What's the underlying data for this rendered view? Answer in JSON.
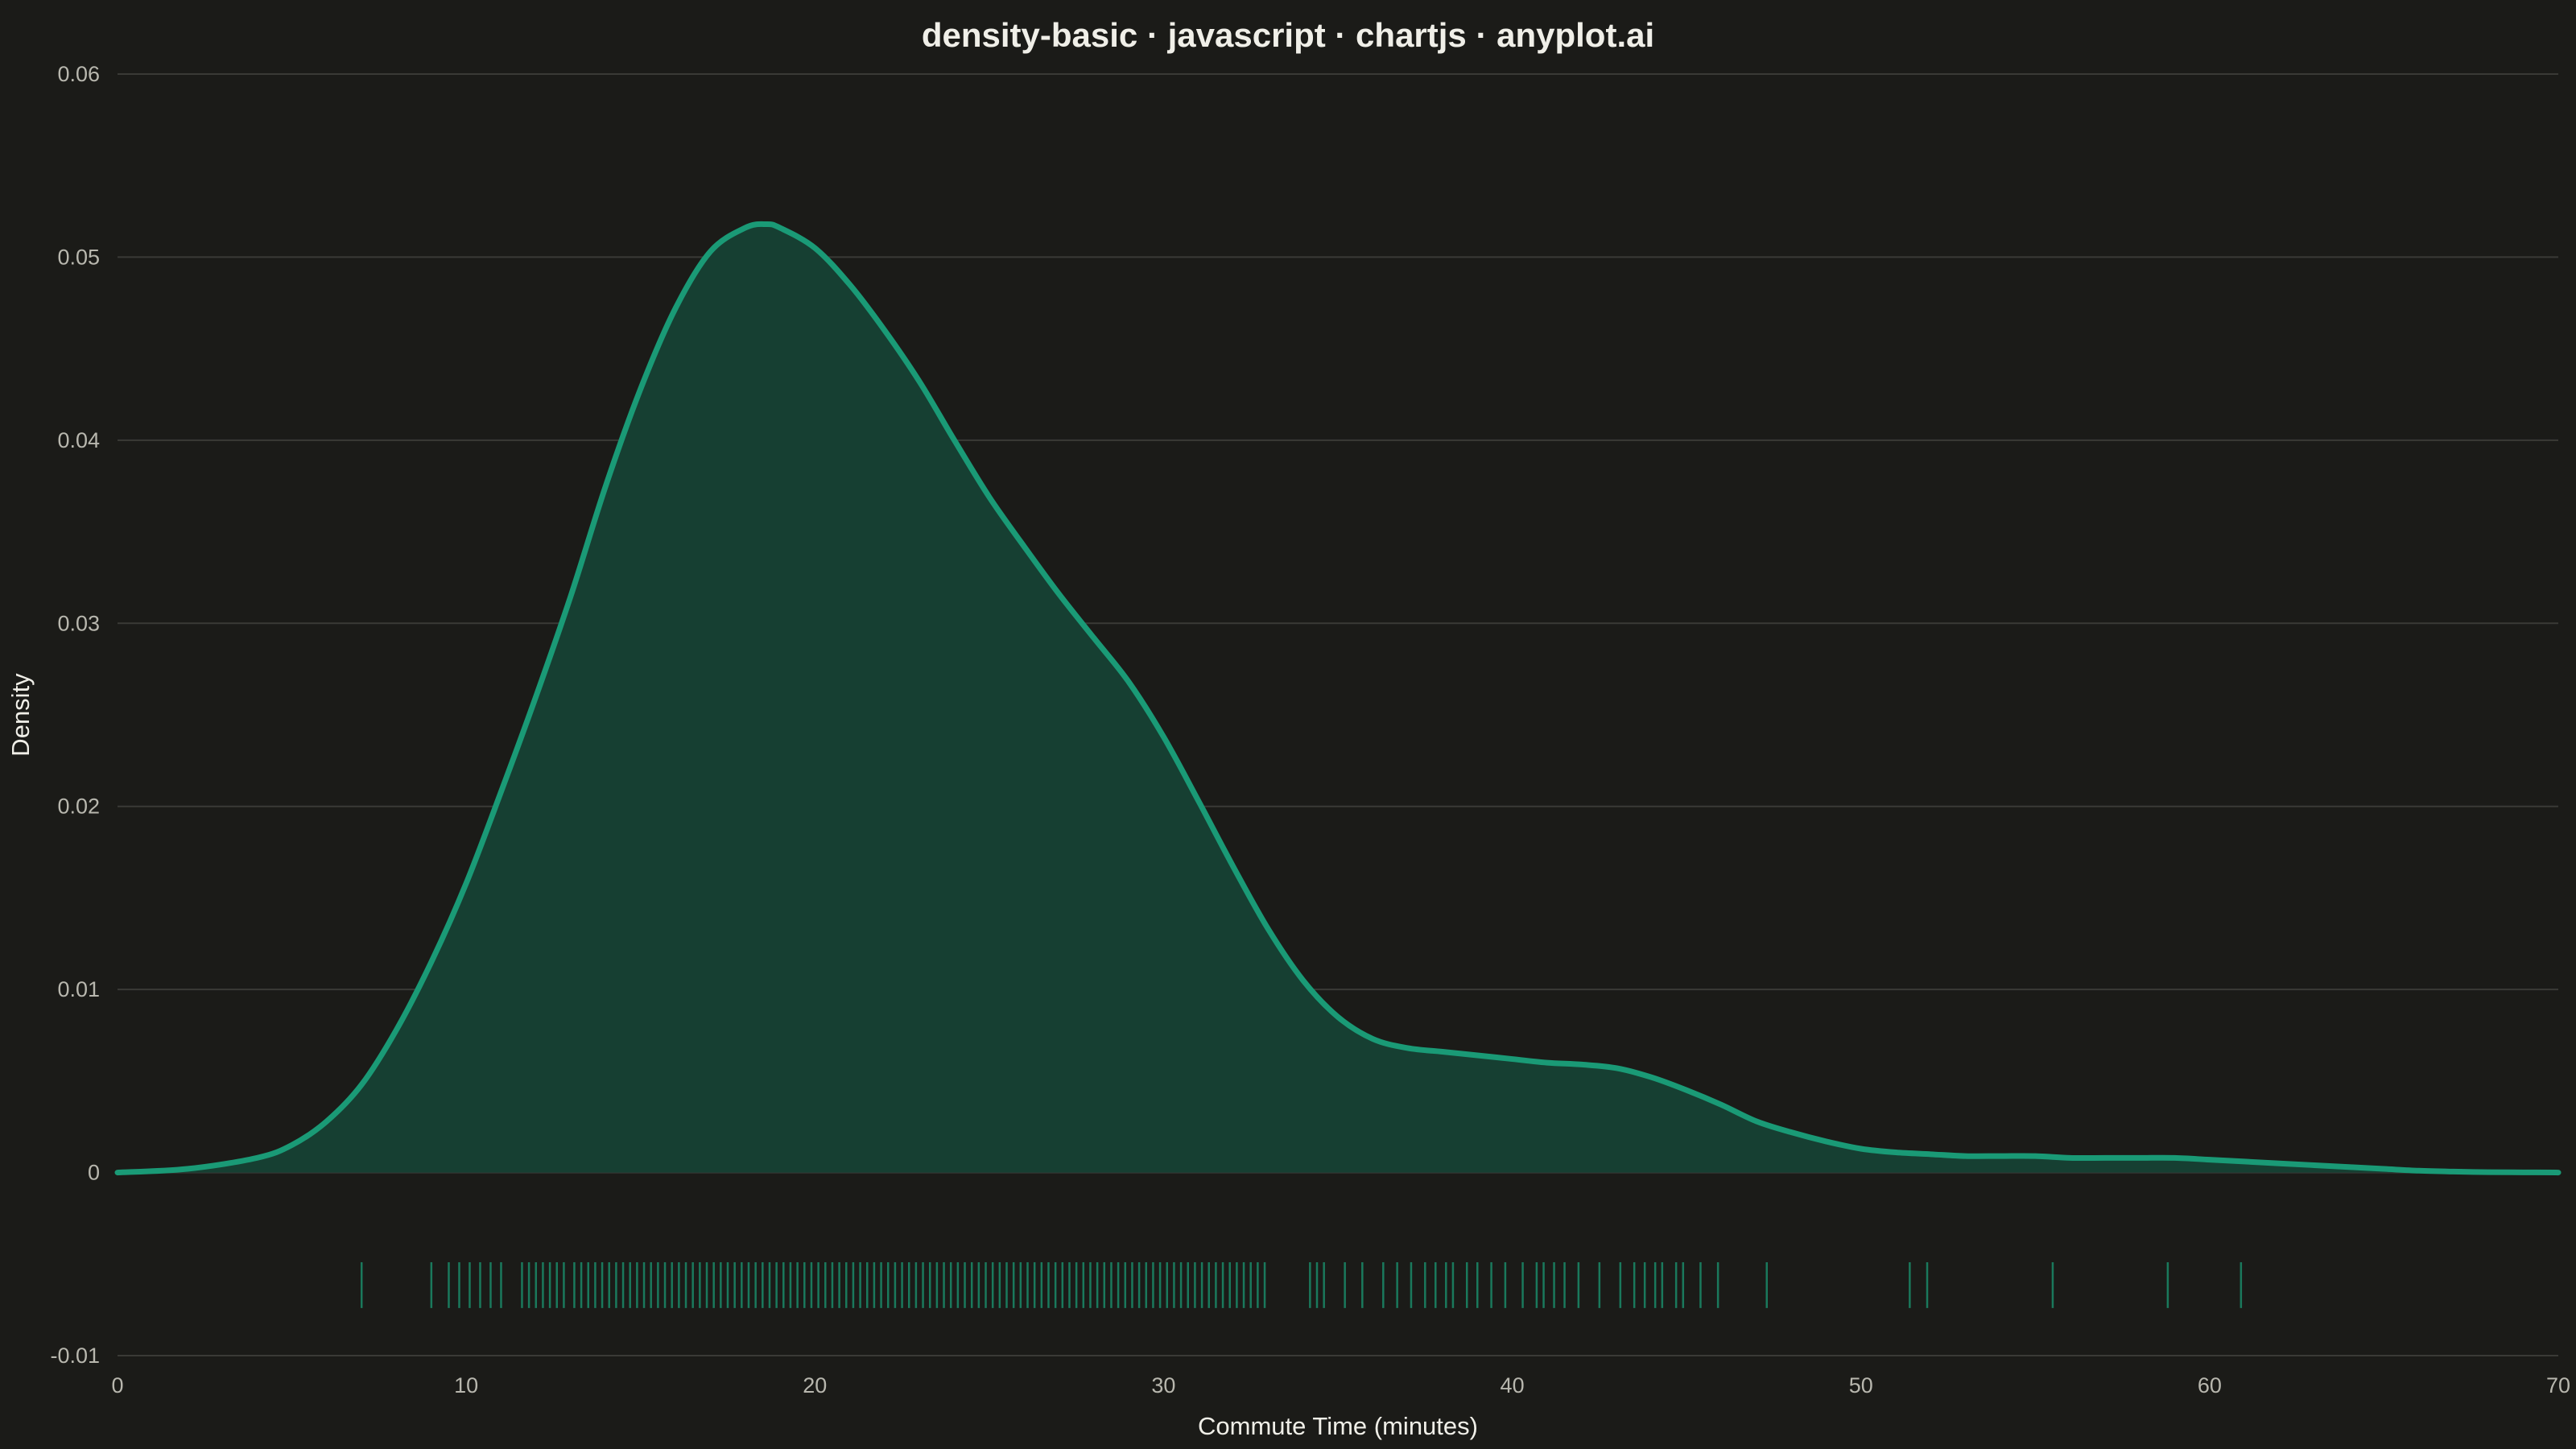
{
  "chart_data": {
    "type": "area",
    "title": "density-basic · javascript · chartjs · anyplot.ai",
    "xlabel": "Commute Time (minutes)",
    "ylabel": "Density",
    "xlim": [
      0,
      70
    ],
    "ylim": [
      -0.01,
      0.06
    ],
    "x_ticks": [
      0,
      10,
      20,
      30,
      40,
      50,
      60,
      70
    ],
    "y_ticks": [
      -0.01,
      0,
      0.01,
      0.02,
      0.03,
      0.04,
      0.05,
      0.06
    ],
    "x_tick_labels": [
      "0",
      "10",
      "20",
      "30",
      "40",
      "50",
      "60",
      "70"
    ],
    "y_tick_labels": [
      "-0.01",
      "0",
      "0.01",
      "0.02",
      "0.03",
      "0.04",
      "0.05",
      "0.06"
    ],
    "grid": true,
    "line_color": "#1a9a76",
    "fill_color": "#163f32",
    "rug_color": "#1a8a68",
    "background": "#1b1b18",
    "series": [
      {
        "x": [
          0,
          2,
          4,
          5,
          6,
          7,
          8,
          9,
          10,
          11,
          12,
          13,
          14,
          15,
          16,
          17,
          18,
          18.6,
          19,
          20,
          21,
          22,
          23,
          24,
          25,
          26,
          27,
          28,
          29,
          30,
          31,
          32,
          33,
          34,
          35,
          36,
          37,
          38,
          39,
          40,
          41,
          42,
          43,
          44,
          45,
          46,
          47,
          48,
          49,
          50,
          51,
          52,
          53,
          54,
          55,
          56,
          57,
          58,
          59,
          60,
          61,
          62,
          63,
          64,
          65,
          66,
          67,
          68,
          69,
          70
        ],
        "y": [
          0,
          0.0002,
          0.0008,
          0.0015,
          0.0028,
          0.0048,
          0.0078,
          0.0115,
          0.0158,
          0.0208,
          0.026,
          0.0315,
          0.0375,
          0.0428,
          0.0472,
          0.0503,
          0.0516,
          0.0518,
          0.0516,
          0.0505,
          0.0485,
          0.046,
          0.0432,
          0.04,
          0.0369,
          0.0342,
          0.0316,
          0.0292,
          0.0268,
          0.0238,
          0.0203,
          0.0167,
          0.0133,
          0.0105,
          0.0085,
          0.0073,
          0.0068,
          0.0066,
          0.0064,
          0.0062,
          0.006,
          0.0059,
          0.0057,
          0.0052,
          0.0045,
          0.0037,
          0.0028,
          0.0022,
          0.0017,
          0.0013,
          0.0011,
          0.001,
          0.0009,
          0.0009,
          0.0009,
          0.0008,
          0.0008,
          0.0008,
          0.0008,
          0.0007,
          0.0006,
          0.0005,
          0.0004,
          0.0003,
          0.0002,
          0.0001,
          5e-05,
          2e-05,
          1e-05,
          0
        ]
      }
    ],
    "rug": [
      7.0,
      9.0,
      9.5,
      9.8,
      10.1,
      10.4,
      10.7,
      11.0,
      11.6,
      11.8,
      12.0,
      12.2,
      12.4,
      12.6,
      12.8,
      13.1,
      13.3,
      13.5,
      13.7,
      13.9,
      14.1,
      14.3,
      14.5,
      14.7,
      14.9,
      15.1,
      15.3,
      15.5,
      15.7,
      15.9,
      16.1,
      16.3,
      16.5,
      16.7,
      16.9,
      17.1,
      17.3,
      17.5,
      17.7,
      17.9,
      18.1,
      18.3,
      18.5,
      18.7,
      18.9,
      19.1,
      19.3,
      19.5,
      19.7,
      19.9,
      20.1,
      20.3,
      20.5,
      20.7,
      20.9,
      21.1,
      21.3,
      21.5,
      21.7,
      21.9,
      22.1,
      22.3,
      22.5,
      22.7,
      22.9,
      23.1,
      23.3,
      23.5,
      23.7,
      23.9,
      24.1,
      24.3,
      24.5,
      24.7,
      24.9,
      25.1,
      25.3,
      25.5,
      25.7,
      25.9,
      26.1,
      26.3,
      26.5,
      26.7,
      26.9,
      27.1,
      27.3,
      27.5,
      27.7,
      27.9,
      28.1,
      28.3,
      28.5,
      28.7,
      28.9,
      29.1,
      29.3,
      29.5,
      29.7,
      29.9,
      30.1,
      30.3,
      30.5,
      30.7,
      30.9,
      31.1,
      31.3,
      31.5,
      31.7,
      31.9,
      32.1,
      32.3,
      32.5,
      32.7,
      32.9,
      34.2,
      34.4,
      34.6,
      35.2,
      35.7,
      36.3,
      36.7,
      37.1,
      37.5,
      37.8,
      38.1,
      38.3,
      38.7,
      39.0,
      39.4,
      39.8,
      40.3,
      40.7,
      40.9,
      41.2,
      41.5,
      41.9,
      42.5,
      43.1,
      43.5,
      43.8,
      44.1,
      44.3,
      44.7,
      44.9,
      45.4,
      45.9,
      47.3,
      51.4,
      51.9,
      55.5,
      58.8,
      60.9
    ]
  }
}
